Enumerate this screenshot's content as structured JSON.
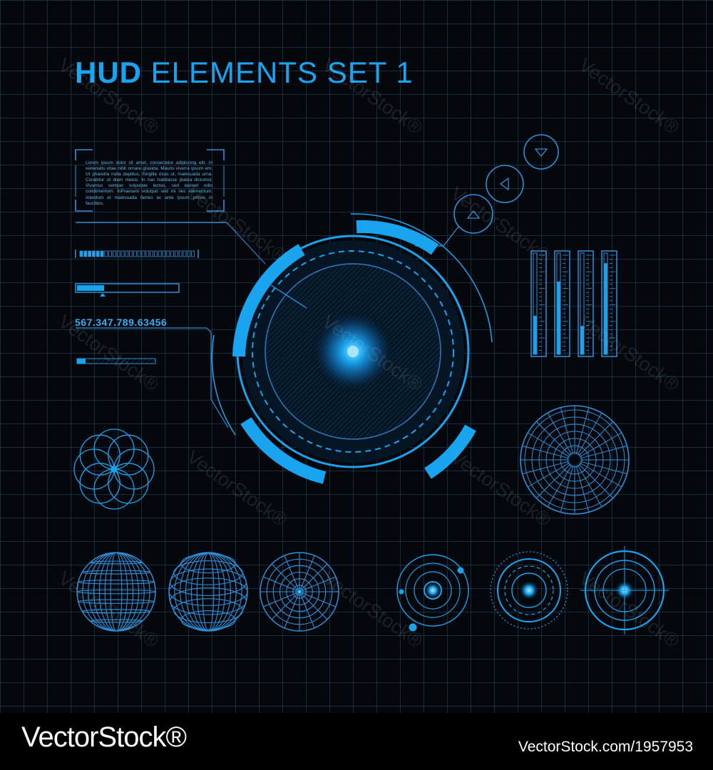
{
  "title": {
    "strong": "HUD",
    "light": "ELEMENTS SET 1"
  },
  "text_panel": {
    "body": "Lorem ipsum dolor sit amet, consectetur adipiscing elit. In venenatis vitae nibh ornare gravida. Mauris viverra ipsum em. Ut pharetra nulla dapibus, fringilla risus ut, malesuada urna. Curabitur ut diam metus. In hac habitasse platea dictumst. Vivamus semper vulputate lectus, sed laoreet odio condimentum. InPraesent volutpat sed mi nec elementum. Interdum et malesuada fames ac ante ipsum primis in faucibus."
  },
  "readout": {
    "value": "567.347.789.63456"
  },
  "watermark": {
    "text": "VectorStock",
    "registered": "®"
  },
  "footer": {
    "logo": "VectorStock®",
    "id": "VectorStock.com/1957953"
  },
  "colors": {
    "accent": "#1aa3ee",
    "line": "#2f8fd8",
    "grid": "#1e3a52",
    "background": "#04080d"
  }
}
